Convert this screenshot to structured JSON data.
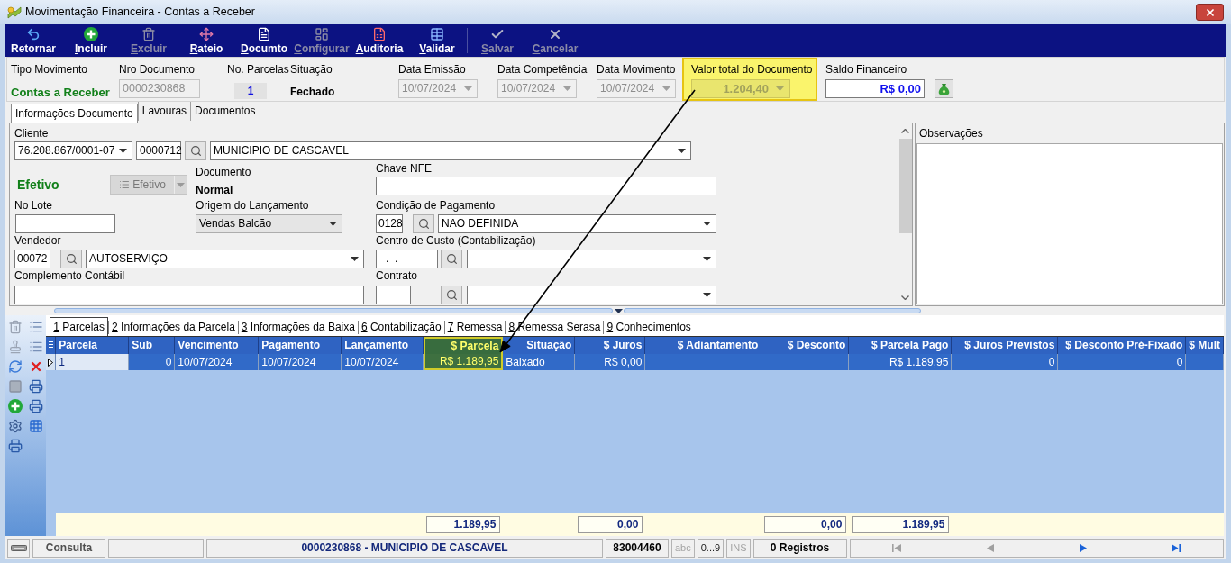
{
  "window": {
    "title": "Movimentação Financeira - Contas a Receber"
  },
  "toolbar": {
    "groups": [
      [
        {
          "label": "Retornar",
          "disabled": false,
          "shortcut_underlined": false
        },
        {
          "label": "Incluir",
          "disabled": false,
          "shortcut_underlined": true
        },
        {
          "label": "Excluir",
          "disabled": true,
          "shortcut_underlined": true
        },
        {
          "label": "Rateio",
          "disabled": false,
          "shortcut_underlined": true
        },
        {
          "label": "Documto",
          "disabled": false,
          "shortcut_underlined": true
        },
        {
          "label": "Configurar",
          "disabled": true,
          "shortcut_underlined": true
        },
        {
          "label": "Auditoria",
          "disabled": false,
          "shortcut_underlined": true
        },
        {
          "label": "Validar",
          "disabled": false,
          "shortcut_underlined": true
        }
      ],
      [
        {
          "label": "Salvar",
          "disabled": true,
          "shortcut_underlined": true
        },
        {
          "label": "Cancelar",
          "disabled": true,
          "shortcut_underlined": true
        }
      ]
    ]
  },
  "header": {
    "tipo_movimento": {
      "label": "Tipo Movimento",
      "value": "Contas a Receber"
    },
    "nro_documento": {
      "label": "Nro Documento",
      "value": "0000230868",
      "disabled": true
    },
    "no_parcelas": {
      "label": "No. Parcelas",
      "value": "1"
    },
    "situacao": {
      "label": "Situação",
      "value": "Fechado"
    },
    "dates": [
      {
        "label": "Data Emissão",
        "value": "10/07/2024",
        "disabled": true
      },
      {
        "label": "Data Competência",
        "value": "10/07/2024",
        "disabled": true
      },
      {
        "label": "Data Movimento",
        "value": "10/07/2024",
        "disabled": true
      }
    ],
    "valor_total": {
      "label": "Valor total do Documento",
      "value": "1.204,40",
      "disabled": true,
      "highlighted": true
    },
    "saldo_financeiro": {
      "label": "Saldo Financeiro",
      "value": "R$ 0,00"
    }
  },
  "document_tabs": [
    {
      "label": "Informações Documento",
      "selected": true
    },
    {
      "label": "Lavouras",
      "selected": false
    },
    {
      "label": "Documentos",
      "selected": false
    }
  ],
  "form": {
    "cliente": {
      "label": "Cliente",
      "document": "76.208.867/0001-07",
      "code": "0000712",
      "name": "MUNICIPIO DE CASCAVEL"
    },
    "efetivo": {
      "status": "Efetivo",
      "button": "Efetivo",
      "button_disabled": true
    },
    "documento": {
      "label": "Documento",
      "value": "Normal"
    },
    "chave_nfe": {
      "label": "Chave NFE"
    },
    "no_lote": {
      "label": "No Lote"
    },
    "origem": {
      "label": "Origem do Lançamento",
      "value": "Vendas Balcão"
    },
    "condicao_pagamento": {
      "label": "Condição de Pagamento",
      "code": "0128",
      "name": "NAO DEFINIDA"
    },
    "vendedor": {
      "label": "Vendedor",
      "code": "00072",
      "name": "AUTOSERVIÇO"
    },
    "centro_custo": {
      "label": "Centro de Custo (Contabilização)",
      "code": ".  ."
    },
    "complemento_contabil": {
      "label": "Complemento Contábil"
    },
    "contrato": {
      "label": "Contrato"
    }
  },
  "observacoes": {
    "label": "Observações"
  },
  "detail_tabs": [
    {
      "label": "1 Parcelas",
      "selected": true
    },
    {
      "label": "2 Informações da Parcela",
      "selected": false
    },
    {
      "label": "3 Informações da Baixa",
      "selected": false
    },
    {
      "label": "6 Contabilização",
      "selected": false
    },
    {
      "label": "7 Remessa",
      "selected": false
    },
    {
      "label": "8 Remessa Serasa",
      "selected": false
    },
    {
      "label": "9 Conhecimentos",
      "selected": false
    }
  ],
  "grid": {
    "columns": [
      {
        "label": "Parcela",
        "highlighted": false
      },
      {
        "label": "Sub",
        "highlighted": false
      },
      {
        "label": "Vencimento",
        "highlighted": false
      },
      {
        "label": "Pagamento",
        "highlighted": false
      },
      {
        "label": "Lançamento",
        "highlighted": false
      },
      {
        "label": "$ Parcela",
        "highlighted": true,
        "total": "1.189,95"
      },
      {
        "label": "Situação",
        "highlighted": false
      },
      {
        "label": "$ Juros",
        "highlighted": false,
        "total": "0,00"
      },
      {
        "label": "$ Adiantamento",
        "highlighted": false
      },
      {
        "label": "$ Desconto",
        "highlighted": false,
        "total": "0,00"
      },
      {
        "label": "$ Parcela Pago",
        "highlighted": false,
        "total": "1.189,95"
      },
      {
        "label": "$ Juros Previstos",
        "highlighted": false
      },
      {
        "label": "$ Desconto Pré-Fixado",
        "highlighted": false
      },
      {
        "label": "$ Mult",
        "highlighted": false
      }
    ],
    "rows": [
      {
        "selected": true,
        "current": true,
        "cells": [
          "1",
          "0",
          "10/07/2024",
          "10/07/2024",
          "10/07/2024",
          "R$ 1.189,95",
          "Baixado",
          "R$ 0,00",
          null,
          null,
          "R$ 1.189,95",
          "0",
          "0",
          null
        ]
      }
    ]
  },
  "status_bar": {
    "mode": "Consulta",
    "record": "0000230868 - MUNICIPIO DE CASCAVEL",
    "code": "83004460",
    "indicators": [
      {
        "label": "abc",
        "active": false
      },
      {
        "label": "0...9",
        "active": true
      },
      {
        "label": "INS",
        "active": false
      }
    ],
    "count": "0 Registros",
    "navigation": [
      {
        "disabled": true
      },
      {
        "disabled": true
      },
      {
        "disabled": false
      },
      {
        "disabled": false
      }
    ]
  }
}
